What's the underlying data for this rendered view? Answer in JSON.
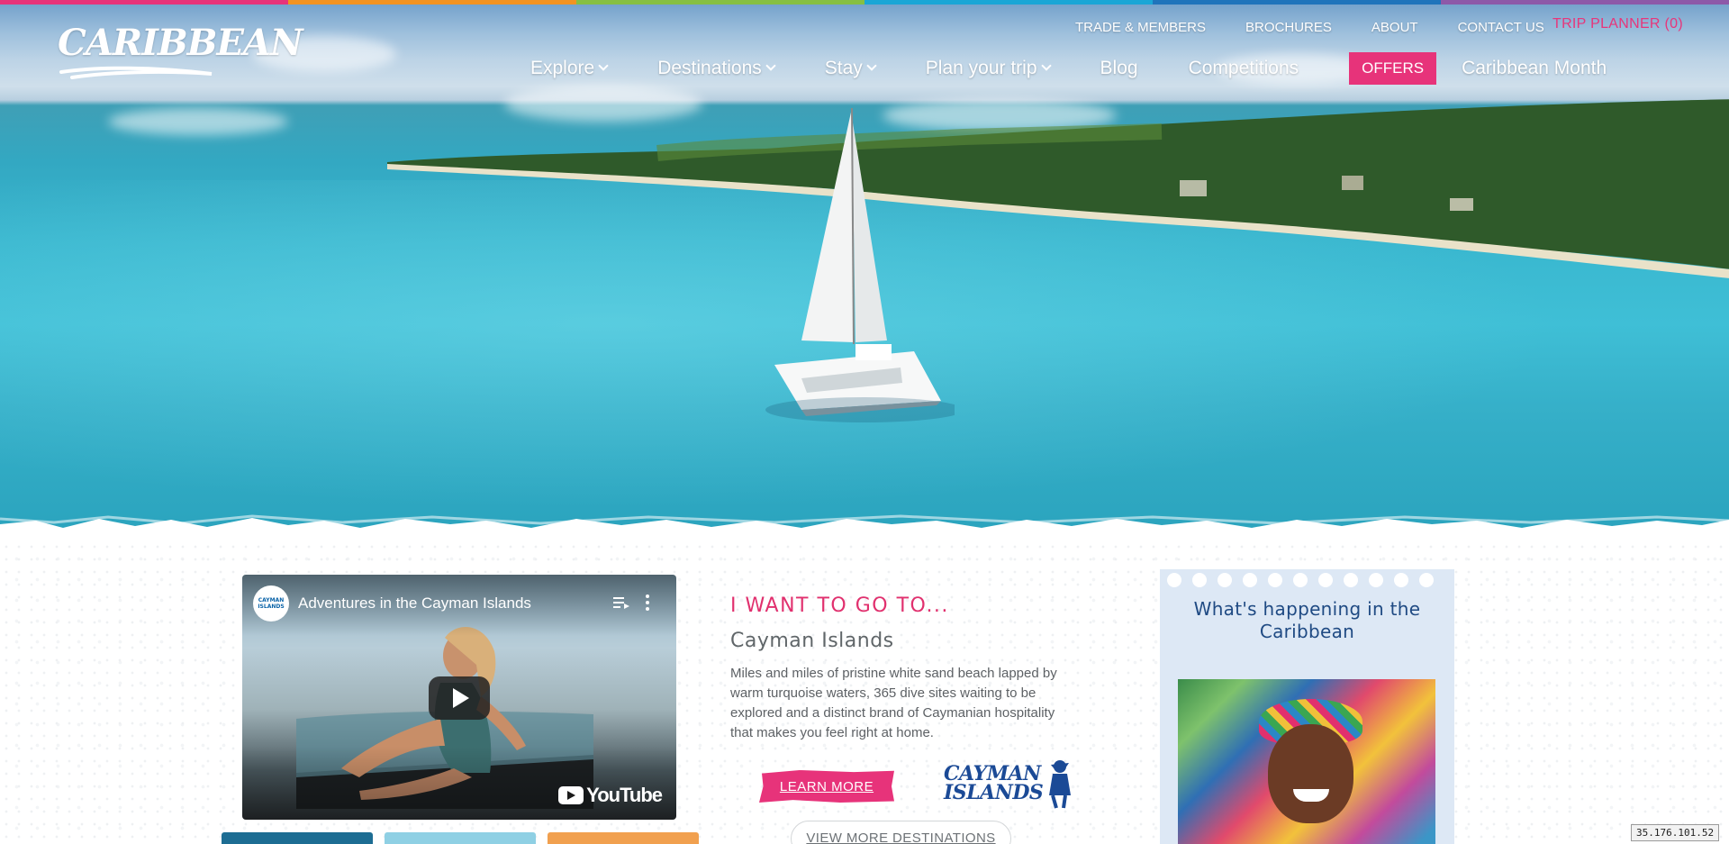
{
  "brand": {
    "logo_text": "CARIBBEAN",
    "stripe_colors": [
      "#e7337a",
      "#f29321",
      "#86bf43",
      "#1aa6d6",
      "#1f74bb",
      "#8d59a8"
    ]
  },
  "utility_nav": {
    "items": [
      "TRADE & MEMBERS",
      "BROCHURES",
      "ABOUT",
      "CONTACT US"
    ],
    "trip_planner": "TRIP PLANNER (0)"
  },
  "main_nav": {
    "items": [
      {
        "label": "Explore",
        "dropdown": true
      },
      {
        "label": "Destinations",
        "dropdown": true
      },
      {
        "label": "Stay",
        "dropdown": true
      },
      {
        "label": "Plan your trip",
        "dropdown": true
      },
      {
        "label": "Blog",
        "dropdown": false
      },
      {
        "label": "Competitions",
        "dropdown": false
      }
    ],
    "offers": "OFFERS",
    "last": "Caribbean Month"
  },
  "video": {
    "channel_badge": "CAYMAN ISLANDS",
    "title": "Adventures in the Cayman Islands",
    "provider": "YouTube",
    "icons": [
      "playlist-icon",
      "more-vert-icon",
      "play-icon",
      "youtube-icon"
    ]
  },
  "pitch": {
    "kicker": "I WANT TO GO TO...",
    "destination": "Cayman Islands",
    "description": "Miles and miles of pristine white sand beach lapped by warm turquoise waters, 365 dive sites waiting to be explored and a distinct brand of Caymanian hospitality that makes you feel right at home.",
    "learn_more": "LEARN MORE",
    "partner_logo": "CAYMAN ISLANDS",
    "view_more": "VIEW MORE DESTINATIONS"
  },
  "happening": {
    "title": "What's happening in the Caribbean"
  },
  "thumbnail_colors": [
    "#1d6d93",
    "#8fd0e4",
    "#f1a04f"
  ],
  "colors": {
    "accent_pink": "#e7337a",
    "navy": "#1f4a83",
    "panel_blue": "#dde8f5"
  },
  "ip_badge": "35.176.101.52"
}
